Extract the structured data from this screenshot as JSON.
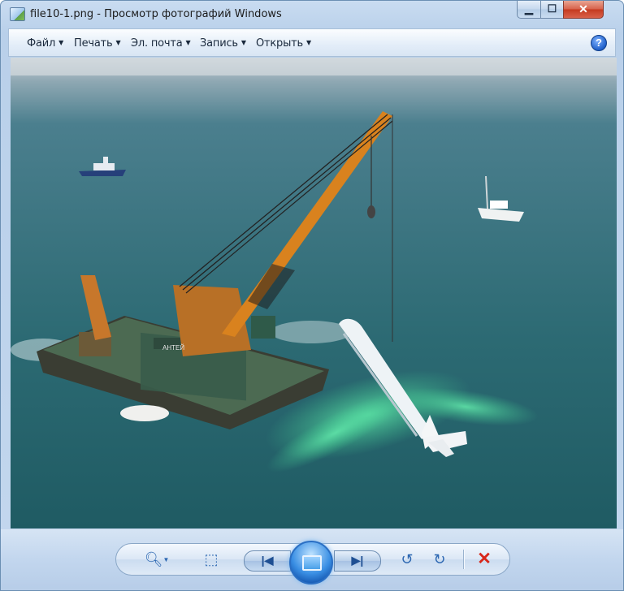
{
  "window": {
    "title": "file10-1.png  -  Просмотр фотографий Windows",
    "controls": {
      "minimize": "▁",
      "maximize": "☐",
      "close": "✕"
    }
  },
  "menu": {
    "items": [
      "Файл",
      "Печать",
      "Эл. почта",
      "Запись",
      "Открыть"
    ],
    "help": "?"
  },
  "photo": {
    "hull_text": "АНТЕЙ"
  },
  "toolbar": {
    "zoom_icon": "magnifier-plus",
    "fit_icon": "actual-size",
    "prev_icon": "skip-previous",
    "slideshow_icon": "slideshow",
    "next_icon": "skip-next",
    "rotate_ccw_icon": "rotate-left",
    "rotate_cw_icon": "rotate-right",
    "delete_icon": "delete-x",
    "colors": {
      "accent": "#2b66b1",
      "delete": "#d8271a"
    }
  }
}
